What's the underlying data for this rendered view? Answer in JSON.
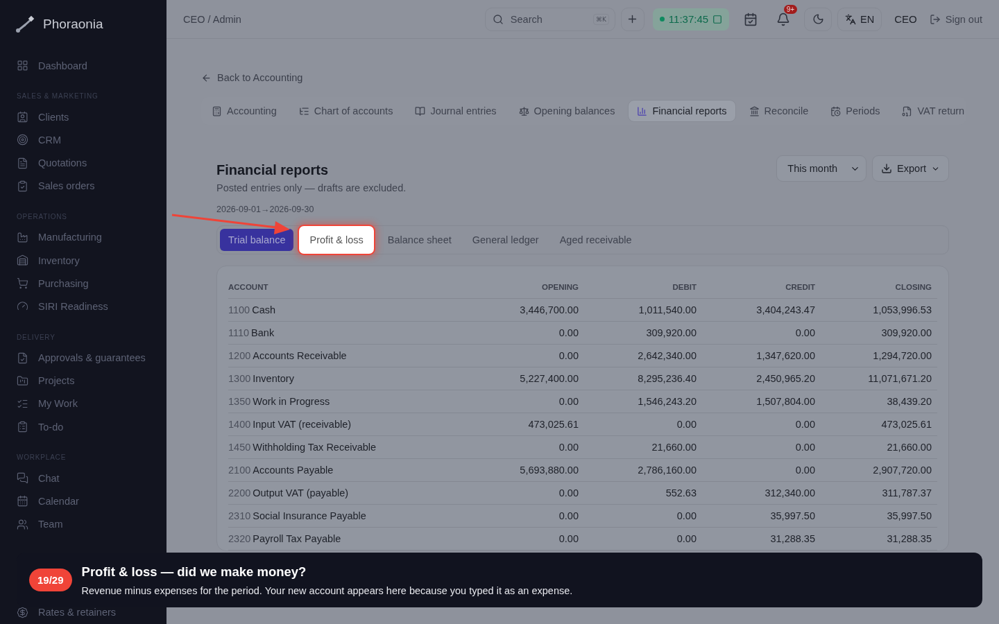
{
  "sidebar": {
    "brand": "Phoraonia",
    "sections": [
      {
        "items": [
          "Dashboard"
        ]
      },
      {
        "heading": "SALES & MARKETING",
        "items": [
          "Clients",
          "CRM",
          "Quotations",
          "Sales orders"
        ]
      },
      {
        "heading": "OPERATIONS",
        "items": [
          "Manufacturing",
          "Inventory",
          "Purchasing",
          "SIRI Readiness"
        ]
      },
      {
        "heading": "DELIVERY",
        "items": [
          "Approvals & guarantees",
          "Projects",
          "My Work",
          "To-do"
        ]
      },
      {
        "heading": "WORKPLACE",
        "items": [
          "Chat",
          "Calendar",
          "Team"
        ]
      },
      {
        "items": [
          "Rates & retainers"
        ]
      }
    ]
  },
  "topbar": {
    "breadcrumb": "CEO / Admin",
    "search": {
      "placeholder": "Search",
      "shortcut": "⌘K"
    },
    "timer": "11:37:45",
    "notifications_badge": "9+",
    "language": "EN",
    "user": "CEO",
    "sign_out": "Sign out"
  },
  "back_link": "Back to Accounting",
  "module_tabs": [
    {
      "label": "Accounting",
      "selected": false
    },
    {
      "label": "Chart of accounts",
      "selected": false
    },
    {
      "label": "Journal entries",
      "selected": false
    },
    {
      "label": "Opening balances",
      "selected": false
    },
    {
      "label": "Financial reports",
      "selected": true
    },
    {
      "label": "Reconcile",
      "selected": false
    },
    {
      "label": "Periods",
      "selected": false
    },
    {
      "label": "VAT return",
      "selected": false
    }
  ],
  "report": {
    "title": "Financial reports",
    "subtitle": "Posted entries only — drafts are excluded.",
    "date_range": "2026-09-01→2026-09-30",
    "period": "This month",
    "export": "Export",
    "tabs": [
      {
        "label": "Trial balance",
        "selected": true,
        "highlighted": false
      },
      {
        "label": "Profit & loss",
        "selected": false,
        "highlighted": true
      },
      {
        "label": "Balance sheet",
        "selected": false,
        "highlighted": false
      },
      {
        "label": "General ledger",
        "selected": false,
        "highlighted": false
      },
      {
        "label": "Aged receivable",
        "selected": false,
        "highlighted": false
      }
    ],
    "table": {
      "columns": [
        "ACCOUNT",
        "OPENING",
        "DEBIT",
        "CREDIT",
        "CLOSING"
      ],
      "rows": [
        {
          "code": "1100",
          "name": "Cash",
          "opening": "3,446,700.00",
          "debit": "1,011,540.00",
          "credit": "3,404,243.47",
          "closing": "1,053,996.53"
        },
        {
          "code": "1110",
          "name": "Bank",
          "opening": "0.00",
          "debit": "309,920.00",
          "credit": "0.00",
          "closing": "309,920.00"
        },
        {
          "code": "1200",
          "name": "Accounts Receivable",
          "opening": "0.00",
          "debit": "2,642,340.00",
          "credit": "1,347,620.00",
          "closing": "1,294,720.00"
        },
        {
          "code": "1300",
          "name": "Inventory",
          "opening": "5,227,400.00",
          "debit": "8,295,236.40",
          "credit": "2,450,965.20",
          "closing": "11,071,671.20"
        },
        {
          "code": "1350",
          "name": "Work in Progress",
          "opening": "0.00",
          "debit": "1,546,243.20",
          "credit": "1,507,804.00",
          "closing": "38,439.20"
        },
        {
          "code": "1400",
          "name": "Input VAT (receivable)",
          "opening": "473,025.61",
          "debit": "0.00",
          "credit": "0.00",
          "closing": "473,025.61"
        },
        {
          "code": "1450",
          "name": "Withholding Tax Receivable",
          "opening": "0.00",
          "debit": "21,660.00",
          "credit": "0.00",
          "closing": "21,660.00"
        },
        {
          "code": "2100",
          "name": "Accounts Payable",
          "opening": "5,693,880.00",
          "debit": "2,786,160.00",
          "credit": "0.00",
          "closing": "2,907,720.00"
        },
        {
          "code": "2200",
          "name": "Output VAT (payable)",
          "opening": "0.00",
          "debit": "552.63",
          "credit": "312,340.00",
          "closing": "311,787.37"
        },
        {
          "code": "2310",
          "name": "Social Insurance Payable",
          "opening": "0.00",
          "debit": "0.00",
          "credit": "35,997.50",
          "closing": "35,997.50"
        },
        {
          "code": "2320",
          "name": "Payroll Tax Payable",
          "opening": "0.00",
          "debit": "0.00",
          "credit": "31,288.35",
          "closing": "31,288.35"
        }
      ]
    }
  },
  "tour": {
    "step": "19/29",
    "title": "Profit & loss — did we make money?",
    "body": "Revenue minus expenses for the period. Your new account appears here because you typed it as an expense."
  }
}
